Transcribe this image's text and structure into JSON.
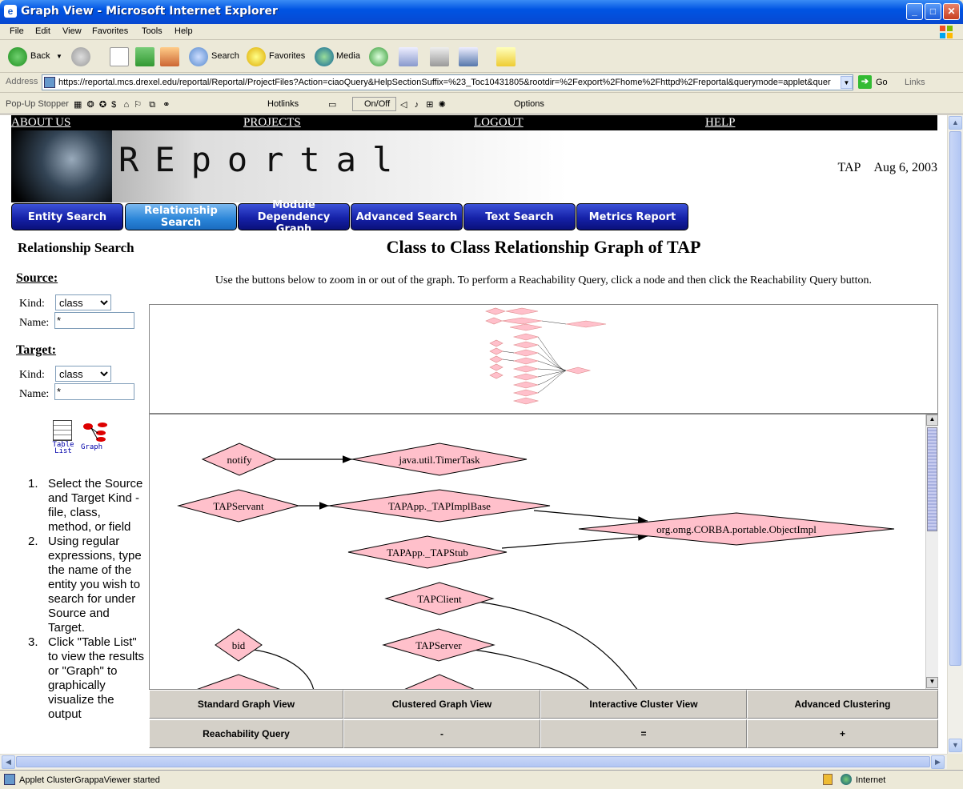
{
  "window": {
    "title": "Graph View - Microsoft Internet Explorer"
  },
  "menu": [
    "File",
    "Edit",
    "View",
    "Favorites",
    "Tools",
    "Help"
  ],
  "toolbar": {
    "back": "Back",
    "search": "Search",
    "favorites": "Favorites",
    "media": "Media"
  },
  "address": {
    "label": "Address",
    "url": "https://reportal.mcs.drexel.edu/reportal/Reportal/ProjectFiles?Action=ciaoQuery&HelpSectionSuffix=%23_Toc10431805&rootdir=%2Fexport%2Fhome%2Fhttpd%2Freportal&querymode=applet&quer",
    "go": "Go",
    "links": "Links"
  },
  "popup_stopper": {
    "label": "Pop-Up Stopper",
    "hotlinks": "Hotlinks",
    "onoff": "On/Off",
    "options": "Options"
  },
  "site_nav": [
    "ABOUT US",
    "PROJECTS",
    "LOGOUT",
    "HELP"
  ],
  "banner": {
    "logo_text": "REportal",
    "project": "TAP",
    "date": "Aug 6, 2003"
  },
  "nav_buttons": [
    "Entity Search",
    "Relationship Search",
    "Module Dependency Graph",
    "Advanced Search",
    "Text Search",
    "Metrics Report"
  ],
  "left": {
    "heading": "Relationship Search",
    "source_label": "Source:",
    "target_label": "Target:",
    "kind_label": "Kind:",
    "name_label": "Name:",
    "source_kind": "class",
    "source_name": "*",
    "target_kind": "class",
    "target_name": "*",
    "table_list_label": "Table List",
    "graph_label": "Graph",
    "instructions": [
      "Select the Source and Target Kind - file, class, method, or field",
      "Using regular expressions, type the name of the entity you wish to search for under Source and Target.",
      "Click \"Table List\" to view the results or \"Graph\" to graphically visualize the output"
    ]
  },
  "main": {
    "title": "Class to Class Relationship Graph of TAP",
    "hint": "Use the buttons below to zoom in or out of the graph. To perform a Reachability Query, click a node and then click the Reachability Query button."
  },
  "graph_nodes": {
    "notify": "notify",
    "timertask": "java.util.TimerTask",
    "tapservant": "TAPServant",
    "tapimplbase": "TAPApp._TAPImplBase",
    "objectimpl": "org.omg.CORBA.portable.ObjectImpl",
    "tapstub": "TAPApp._TAPStub",
    "tapclient": "TAPClient",
    "bid": "bid",
    "tapserver": "TAPServer"
  },
  "graph_buttons": [
    "Standard Graph View",
    "Clustered Graph View",
    "Interactive Cluster View",
    "Advanced Clustering",
    "Reachability Query",
    "-",
    "=",
    "+"
  ],
  "status": {
    "text": "Applet ClusterGrappaViewer started",
    "zone": "Internet"
  }
}
